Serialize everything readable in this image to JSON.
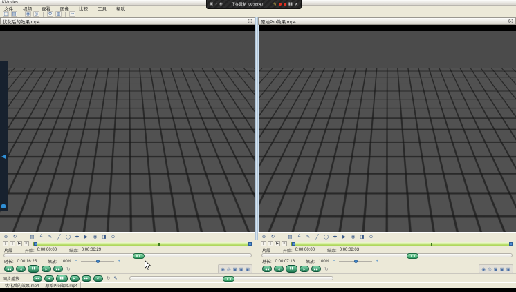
{
  "window": {
    "title": "KMovies"
  },
  "recorder": {
    "status": "正在录制 [00:09:47]",
    "icons_left": [
      "▣",
      "♪",
      "◉",
      "▸"
    ],
    "pencil": "✎",
    "pause": "▮▮",
    "close": "✕"
  },
  "menu": {
    "items": [
      "文件",
      "视频",
      "查看",
      "图像",
      "比较",
      "工具",
      "帮助"
    ]
  },
  "toolbar": {
    "icons": [
      {
        "name": "open",
        "glyph": "◫"
      },
      {
        "name": "layout",
        "glyph": "▤"
      },
      {
        "name": "snapshot-left",
        "glyph": "◉"
      },
      {
        "name": "snapshot-right",
        "glyph": "◎"
      },
      {
        "name": "settings",
        "glyph": "⚙"
      },
      {
        "name": "grid",
        "glyph": "▥"
      },
      {
        "name": "export",
        "glyph": "↪"
      }
    ]
  },
  "annotation": {
    "icons": [
      {
        "name": "pan",
        "glyph": "⊕"
      },
      {
        "name": "rotate",
        "glyph": "↻"
      },
      {
        "name": "image",
        "glyph": "▤"
      },
      {
        "name": "text",
        "glyph": "A"
      },
      {
        "name": "pencil",
        "glyph": "✎"
      },
      {
        "name": "line",
        "glyph": "╱"
      },
      {
        "name": "ellipse",
        "glyph": "◯"
      },
      {
        "name": "cross",
        "glyph": "✚"
      },
      {
        "name": "play-marker",
        "glyph": "▶"
      },
      {
        "name": "target",
        "glyph": "◉"
      },
      {
        "name": "half-tone",
        "glyph": "◨"
      },
      {
        "name": "magnifier",
        "glyph": "⊙"
      }
    ]
  },
  "transport": {
    "go_start": "◀◀",
    "step_back": "◀",
    "pause": "▮▮",
    "step_forward": "▶",
    "go_end": "▶▶",
    "loop": "↻"
  },
  "clip_buttons": {
    "set_start": "[",
    "set_end": "]",
    "play_clip": "▶",
    "list": "≡"
  },
  "capture_icons": [
    {
      "name": "snapshot",
      "glyph": "◉"
    },
    {
      "name": "snapshot-both",
      "glyph": "◎"
    },
    {
      "name": "mark-in",
      "glyph": "▣"
    },
    {
      "name": "mark-out",
      "glyph": "▣"
    },
    {
      "name": "save-marks",
      "glyph": "▣"
    }
  ],
  "controls": {
    "zoom_minus": "−",
    "zoom_plus": "+"
  },
  "panels": [
    {
      "title": "优化后的效果.mp4",
      "clip_label": "片段",
      "start_label": "开始:",
      "start_value": "0:00:00:00",
      "end_label": "结束:",
      "end_value": "0:00:06:29",
      "duration_label": "时长:",
      "duration_value": "0:00:16:25",
      "zoom_label": "缩放:",
      "zoom_value": "100%"
    },
    {
      "title": "原始Pro效果.mp4",
      "clip_label": "片段",
      "start_label": "开始:",
      "start_value": "0:00:00:00",
      "end_label": "结束:",
      "end_value": "0:00:08:03",
      "duration_label": "总长:",
      "duration_value": "0:00:07:16",
      "zoom_label": "缩放:",
      "zoom_value": "100%"
    }
  ],
  "sync": {
    "label": "同步播放:",
    "link_glyph": "⇄",
    "brush_glyph": "✎"
  },
  "statusbar": {
    "left_file": "优化后的效果.mp4",
    "right_file": "原始Pro效果.mp4"
  }
}
